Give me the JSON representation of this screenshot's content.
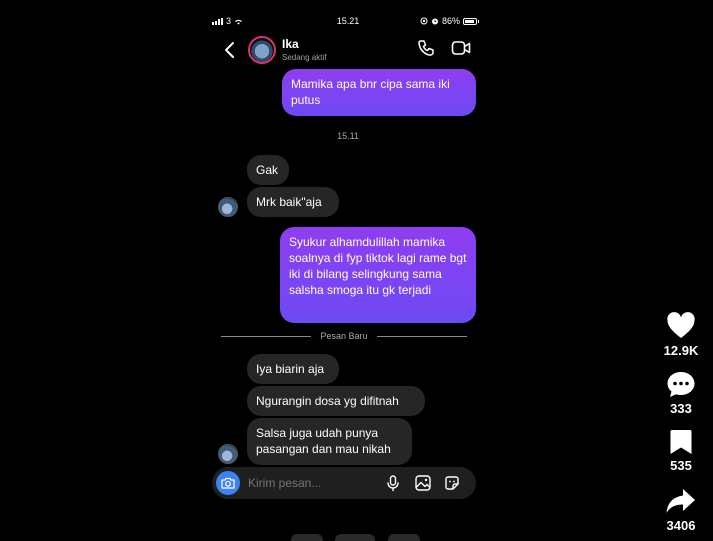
{
  "status_bar": {
    "carrier": "3",
    "time": "15.21",
    "battery": "86%"
  },
  "header": {
    "name": "Ika",
    "status": "Sedang aktif"
  },
  "messages": {
    "out1": "Mamika apa bnr cipa sama iki putus",
    "timestamp": "15.11",
    "in1": "Gak",
    "in2": "Mrk baik\"aja",
    "out2": "Syukur alhamdulillah mamika soalnya di fyp tiktok lagi rame bgt iki di bilang selingkung sama salsha smoga itu gk terjadi",
    "divider": "Pesan Baru",
    "in3": "Iya biarin aja",
    "in4": "Ngurangin dosa yg difitnah",
    "in5": "Salsa juga udah punya pasangan dan mau nikah"
  },
  "composer": {
    "placeholder": "Kirim pesan..."
  },
  "rail": {
    "likes": "12.9K",
    "comments": "333",
    "saves": "535",
    "shares": "3406"
  },
  "colors": {
    "outgoing_start": "#8f3df0",
    "outgoing_end": "#6d4af4",
    "incoming": "#262626",
    "camera": "#3b82f6"
  },
  "icons": [
    "signal-icon",
    "wifi-icon",
    "alarm-icon",
    "battery-icon",
    "back-icon",
    "phone-icon",
    "video-icon",
    "camera-icon",
    "mic-icon",
    "gallery-icon",
    "sticker-icon",
    "heart-icon",
    "comment-icon",
    "bookmark-icon",
    "share-icon"
  ]
}
